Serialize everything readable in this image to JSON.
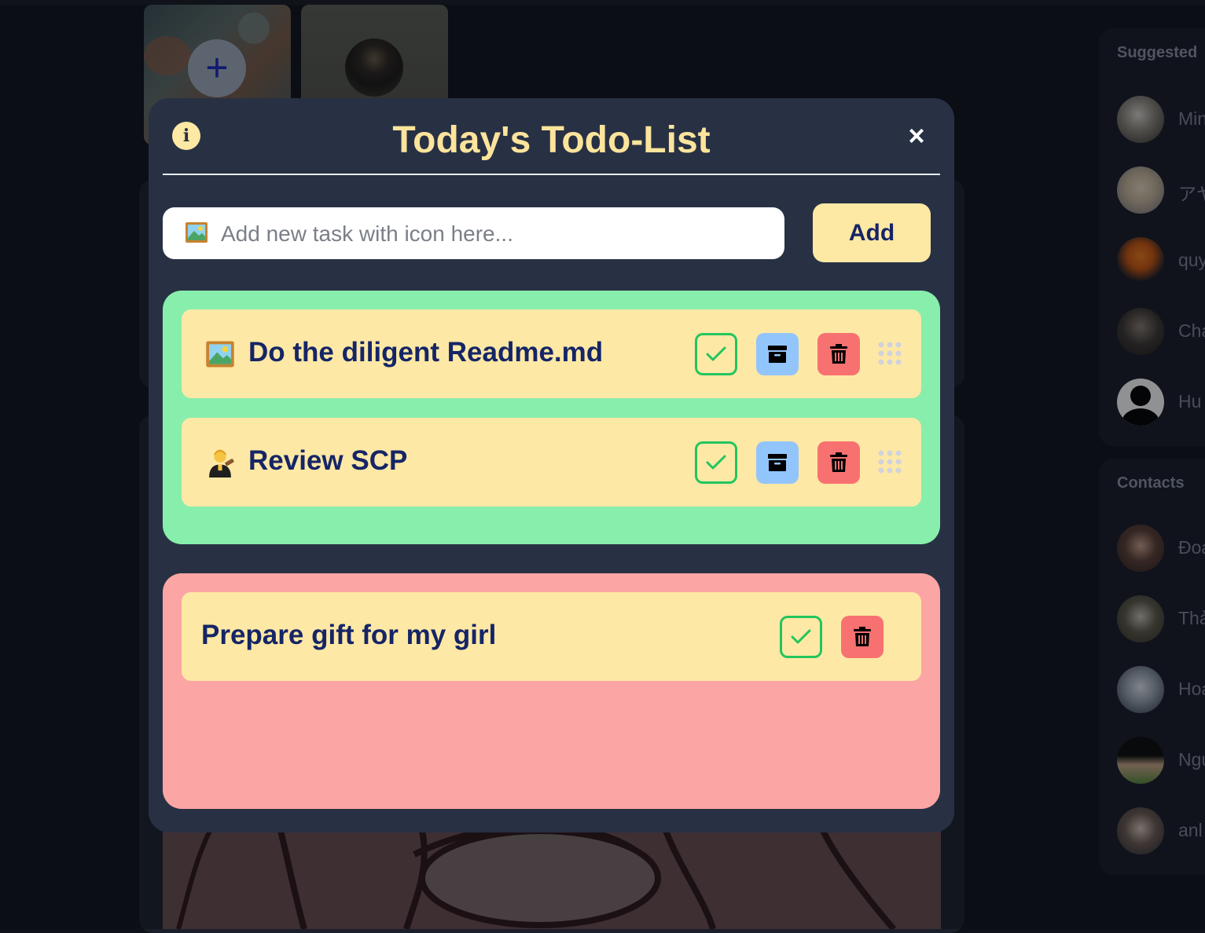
{
  "stories": {
    "add_symbol": "+"
  },
  "sidebar": {
    "suggested_title": "Suggested",
    "suggested": [
      {
        "name": "Min"
      },
      {
        "name": "アヤ"
      },
      {
        "name": "quy"
      },
      {
        "name": "Cha"
      },
      {
        "name": "Hu"
      }
    ],
    "contacts_title": "Contacts",
    "contacts": [
      {
        "name": "Đoa"
      },
      {
        "name": "Thả"
      },
      {
        "name": "Hoa"
      },
      {
        "name": "Ngu"
      },
      {
        "name": "anl"
      }
    ]
  },
  "modal": {
    "title": "Today's Todo-List",
    "info_symbol": "i",
    "close_symbol": "×",
    "input": {
      "placeholder": "Add new task with icon here...",
      "value": "",
      "emoji_icon": "framed-picture-icon"
    },
    "add_label": "Add",
    "active_tasks": [
      {
        "label": "Do the diligent Readme.md",
        "icon": "framed-picture-icon"
      },
      {
        "label": "Review SCP",
        "icon": "judge-icon"
      }
    ],
    "done_tasks": [
      {
        "label": "Prepare gift for my girl"
      }
    ]
  },
  "colors": {
    "modal_bg": "#283144",
    "title": "#fde49c",
    "active_zone": "#88eeac",
    "done_zone": "#fca5a5",
    "task_card": "#fee8a5",
    "task_text": "#152566",
    "check_border": "#22c55e",
    "archive_bg": "#93c5fd",
    "delete_bg": "#f87171"
  }
}
